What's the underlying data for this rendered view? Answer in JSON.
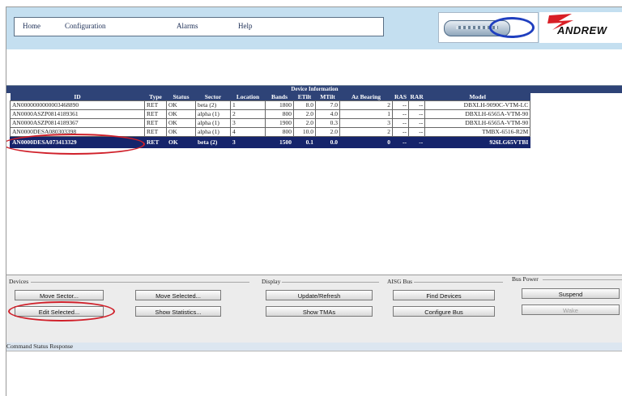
{
  "menu": {
    "home": "Home",
    "configuration": "Configuration",
    "alarms": "Alarms",
    "help": "Help"
  },
  "logo": {
    "brand": "ANDREW"
  },
  "device_info": {
    "title": "Device Information",
    "columns": [
      "ID",
      "Type",
      "Status",
      "Sector",
      "Location",
      "Bands",
      "ETilt",
      "MTilt",
      "Az Bearing",
      "RAS",
      "RAR",
      "Model"
    ],
    "rows": [
      [
        "AN0000000000003468890",
        "RET",
        "OK",
        "beta (2)",
        "1",
        "1800",
        "8.0",
        "7.0",
        "2",
        "--",
        "--",
        "DBXLH-9090C-VTM-LC"
      ],
      [
        "AN0000ASZP0814189361",
        "RET",
        "OK",
        "alpha (1)",
        "2",
        "800",
        "2.0",
        "4.0",
        "1",
        "--",
        "--",
        "DBXLH-6565A-VTM-90"
      ],
      [
        "AN0000ASZP0814189367",
        "RET",
        "OK",
        "alpha (1)",
        "3",
        "1900",
        "2.0",
        "0.3",
        "3",
        "--",
        "--",
        "DBXLH-6565A-VTM-90"
      ],
      [
        "AN0000DESA080303398",
        "RET",
        "OK",
        "alpha (1)",
        "4",
        "800",
        "10.0",
        "2.0",
        "2",
        "--",
        "--",
        "TMBX-6516-R2M"
      ],
      [
        "AN0000DESA073413329",
        "RET",
        "OK",
        "beta (2)",
        "3",
        "1500",
        "0.1",
        "0.0",
        "0",
        "--",
        "--",
        "926LG65VTBI"
      ]
    ],
    "selected_row": 4
  },
  "devices": {
    "label": "Devices",
    "move_sector": "Move Sector...",
    "move_selected": "Move Selected...",
    "edit_selected": "Edit Selected...",
    "show_statistics": "Show Statistics..."
  },
  "display": {
    "label": "Display",
    "update_refresh": "Update/Refresh",
    "show_tmas": "Show TMAs"
  },
  "aisg_bus": {
    "label": "AISG Bus",
    "find_devices": "Find Devices",
    "configure_bus": "Configure Bus"
  },
  "bus_power": {
    "label": "Bus Power",
    "suspend": "Suspend",
    "wake": "Wake"
  },
  "status": {
    "label": "Command Status Response"
  },
  "colors": {
    "header_bg": "#c4dff0",
    "table_header": "#2e4377",
    "selected_row": "#15246b",
    "highlight_red": "#d0202a"
  }
}
